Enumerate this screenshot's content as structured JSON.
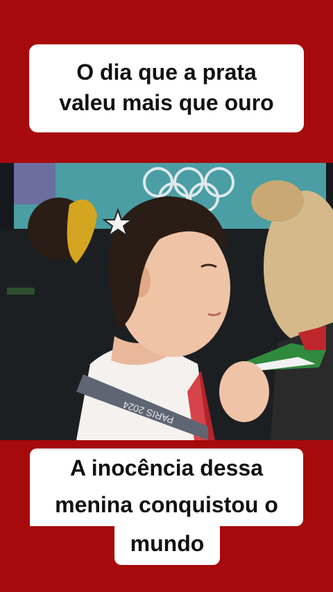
{
  "top_caption": {
    "line1": "O dia que a prata",
    "line2": "valeu mais que ouro"
  },
  "video": {
    "medal_ribbon_text": "PARIS 2024",
    "description_icon": "olympic-rings-icon"
  },
  "bottom_caption": {
    "line1": "A inocência dessa",
    "line2": "menina conquistou o",
    "line3": "mundo"
  },
  "colors": {
    "background": "#a70a0c",
    "caption_bg": "#ffffff",
    "caption_text": "#111111"
  }
}
